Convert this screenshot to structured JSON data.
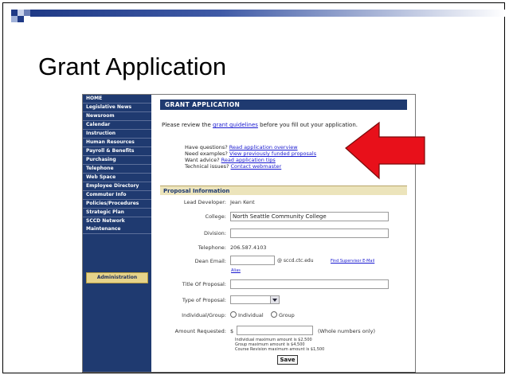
{
  "slide": {
    "title": "Grant Application"
  },
  "sidebar": {
    "items": [
      "HOME",
      "Legislative News",
      "Newsroom",
      "Calendar",
      "Instruction",
      "Human Resources",
      "Payroll & Benefits",
      "Purchasing",
      "Telephone",
      "Web Space",
      "Employee Directory",
      "Commuter Info",
      "Policies/Procedures",
      "Strategic Plan",
      "SCCD Network Maintenance"
    ],
    "admin_label": "Administration"
  },
  "form": {
    "header": "GRANT APPLICATION",
    "intro_before": "Please review the ",
    "intro_link": "grant guidelines",
    "intro_after": " before you fill out your application.",
    "help": [
      {
        "prefix": "Have questions? ",
        "link": "Read application overview"
      },
      {
        "prefix": "Need examples? ",
        "link": "View previously funded proposals"
      },
      {
        "prefix": "Want advice? ",
        "link": "Read application tips"
      },
      {
        "prefix": "Technical issues? ",
        "link": "Contact webmaster"
      }
    ],
    "section_title": "Proposal Information",
    "lead_developer_label": "Lead Developer:",
    "lead_developer_value": "Jean Kent",
    "college_label": "College:",
    "college_value": "North Seattle Community College",
    "division_label": "Division:",
    "division_value": "",
    "telephone_label": "Telephone:",
    "telephone_value": "206.587.4103",
    "dean_email_label": "Dean Email:",
    "dean_email_value": "",
    "dean_email_suffix": "@ sccd.ctc.edu",
    "find_supervisor_link": "Find Supervisor E-Mail",
    "alias_link": "Alias",
    "title_label": "Title Of Proposal:",
    "title_value": "",
    "type_label": "Type of Proposal:",
    "type_value": "",
    "individual_group_label": "Individual/Group:",
    "radio_individual": "Individual",
    "radio_group": "Group",
    "amount_label": "Amount Requested:",
    "amount_currency": "$",
    "amount_value": "",
    "amount_note": "(Whole numbers only)",
    "max_individual": "Individual maximum amount is $2,500",
    "max_group": "Group maximum amount is $4,500",
    "max_course": "Course Revision maximum amount is $1,500",
    "save_label": "Save"
  },
  "colors": {
    "nav_bg": "#1f3a70",
    "section_bg": "#ece4bb",
    "admin_bg": "#e6d38a",
    "arrow": "#e8101a",
    "link": "#1a1ad0"
  }
}
